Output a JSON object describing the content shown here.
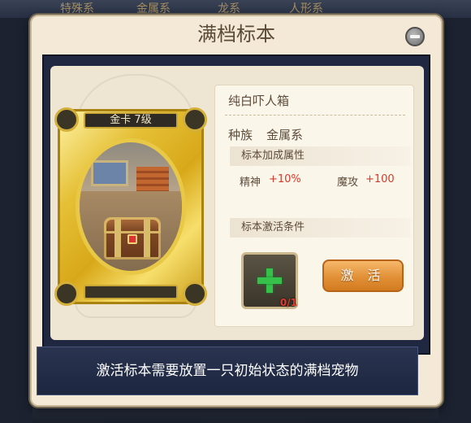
{
  "background_tabs": [
    "特殊系",
    "金属系",
    "龙系",
    "人形系"
  ],
  "modal": {
    "title": "满档标本",
    "close_icon": "minus-circle-icon"
  },
  "card": {
    "header": "金卡  7级",
    "image": "treasure-chest"
  },
  "pet": {
    "name": "纯白吓人箱",
    "race_label": "种族",
    "race_value": "金属系"
  },
  "bonus": {
    "header": "标本加成属性",
    "attrs": [
      {
        "label": "精神",
        "value": "+10%"
      },
      {
        "label": "魔攻",
        "value": "+100"
      }
    ]
  },
  "activation": {
    "header": "标本激活条件",
    "slot_icon": "plus-icon",
    "slot_count": "0/1",
    "button_label": "激 活"
  },
  "instruction": "激活标本需要放置一只初始状态的满档宠物",
  "colors": {
    "accent_orange": "#e08d33",
    "value_red": "#d9392c",
    "plus_green": "#36c24a",
    "gold": "#d8a819"
  }
}
